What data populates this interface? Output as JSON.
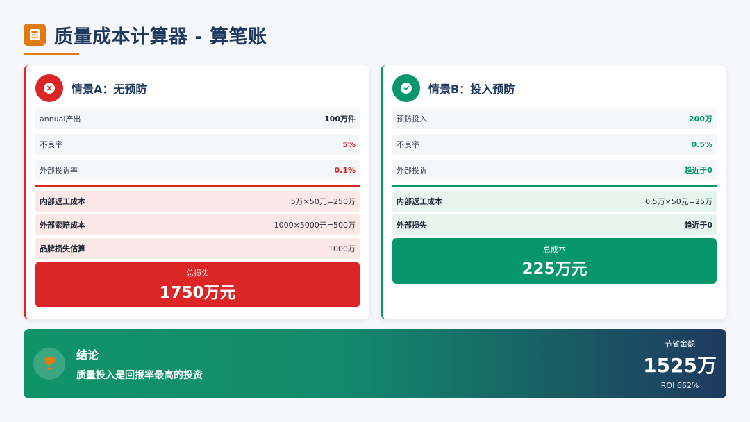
{
  "header": {
    "title": "质量成本计算器 - 算笔账",
    "icon": "calculator-icon",
    "accent_color": "#e07b14"
  },
  "scenario_a": {
    "title": "情景A：无预防",
    "icon": "close-icon",
    "color": "#dc2626",
    "params": [
      {
        "label": "annual产出",
        "value": "100万件"
      },
      {
        "label": "不良率",
        "value": "5%"
      },
      {
        "label": "外部投诉率",
        "value": "0.1%"
      }
    ],
    "costs": [
      {
        "label": "内部返工成本",
        "value": "5万×50元=250万"
      },
      {
        "label": "外部索赔成本",
        "value": "1000×5000元=500万"
      },
      {
        "label": "品牌损失估算",
        "value": "1000万"
      }
    ],
    "total_label": "总损失",
    "total_value": "1750万元"
  },
  "scenario_b": {
    "title": "情景B：投入预防",
    "icon": "check-icon",
    "color": "#059669",
    "params": [
      {
        "label": "预防投入",
        "value": "200万"
      },
      {
        "label": "不良率",
        "value": "0.5%"
      },
      {
        "label": "外部投诉",
        "value": "趋近于0"
      }
    ],
    "costs": [
      {
        "label": "内部返工成本",
        "value": "0.5万×50元=25万"
      },
      {
        "label": "外部损失",
        "value": "趋近于0"
      }
    ],
    "total_label": "总成本",
    "total_value": "225万元"
  },
  "conclusion": {
    "icon": "trophy-icon",
    "title": "结论",
    "body": "质量投入是回报率最高的投资",
    "savings_label": "节省金额",
    "savings_value": "1525万",
    "roi": "ROI 662%"
  }
}
